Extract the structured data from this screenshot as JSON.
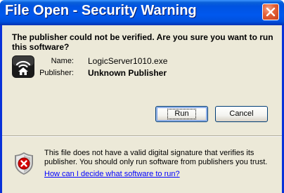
{
  "window": {
    "title": "File Open - Security Warning"
  },
  "dialog": {
    "question": "The publisher could not be verified.  Are you sure you want to run this software?",
    "fields": {
      "name_label": "Name:",
      "name_value": "LogicServer1010.exe",
      "publisher_label": "Publisher:",
      "publisher_value": "Unknown Publisher"
    },
    "buttons": {
      "run_label": "Run",
      "cancel_label": "Cancel"
    },
    "warning": {
      "text": "This file does not have a valid digital signature that verifies its publisher.  You should only run software from publishers you trust.",
      "link": "How can I decide what software to run?"
    }
  },
  "icons": {
    "close": "close-icon",
    "app": "wifi-home-app-icon",
    "warning": "shield-error-icon"
  },
  "colors": {
    "titlebar": "#0058ee",
    "client_bg": "#ece9d8",
    "link": "#0000ff",
    "close_button": "#e35f35"
  }
}
